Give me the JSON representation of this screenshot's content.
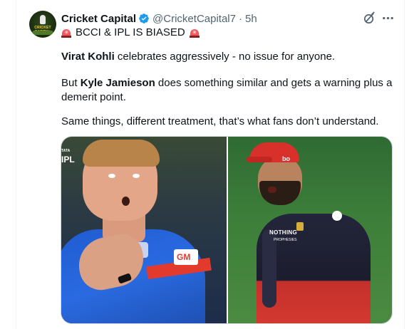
{
  "tweet": {
    "author": {
      "name": "Cricket Capital",
      "handle": "@CricketCapital7",
      "separator": "·",
      "time": "5h",
      "avatar_label": "CRICKET CAPITAL",
      "verified": true
    },
    "line1": "BCCI & IPL IS BIASED",
    "line2": {
      "bold": "Virat Kohli",
      "rest": " celebrates aggressively - no issue for anyone."
    },
    "line3": {
      "prefix": "But ",
      "bold": "Kyle Jamieson",
      "rest": " does something similar and gets a warning plus a"
    },
    "line4": "demerit point.",
    "line5": "Same things, different treatment, that’s what fans don’t understand."
  },
  "media": {
    "left_photo": {
      "broadcast_mark": "IPL",
      "broadcast_small": "TATA",
      "sponsor_text": "GM"
    },
    "right_photo": {
      "cap_text": "bo",
      "chest_text": "NOTHING",
      "chest_subtext": "PROPHESIES"
    }
  },
  "icons": {
    "verified": "verified-badge-icon",
    "grok": "grok-icon",
    "more": "more-icon",
    "siren": "police-light-emoji"
  },
  "colors": {
    "text": "#0f1419",
    "secondary": "#536471",
    "verified": "#1d9bf0",
    "border": "#cfd9de"
  }
}
